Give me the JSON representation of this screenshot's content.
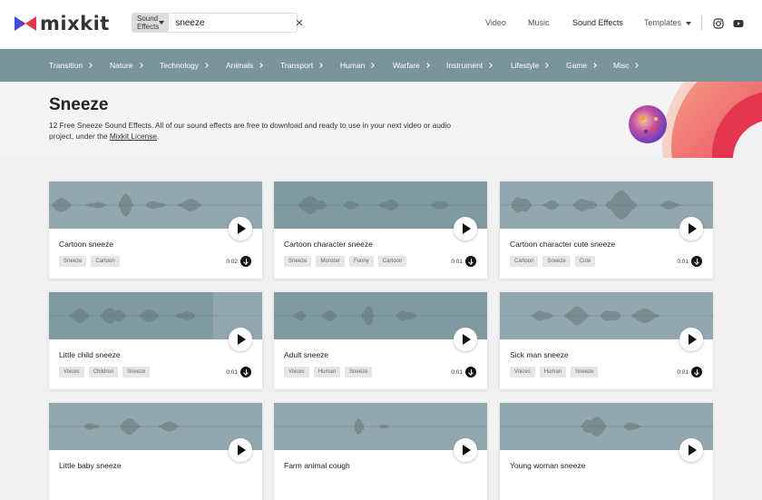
{
  "header": {
    "logo_text": "mixkit",
    "search": {
      "category": "Sound Effects",
      "query": "sneeze",
      "clear": "✕"
    },
    "nav": [
      "Video",
      "Music",
      "Sound Effects",
      "Templates"
    ]
  },
  "categories": [
    "Transition",
    "Nature",
    "Technology",
    "Animals",
    "Transport",
    "Human",
    "Warfare",
    "Instrument",
    "Lifestyle",
    "Game",
    "Misc"
  ],
  "hero": {
    "title": "Sneeze",
    "desc_before": "12 Free Sneeze Sound Effects. All of our sound effects are free to download and ready to use in your next video or audio project, under the ",
    "license_link": "Mixkit License",
    "desc_after": "."
  },
  "cards": [
    {
      "title": "Cartoon sneeze",
      "tags": [
        "Sneeze",
        "Cartoon"
      ],
      "duration": "0:02",
      "progress": 0
    },
    {
      "title": "Cartoon character sneeze",
      "tags": [
        "Sneeze",
        "Monster",
        "Funny",
        "Cartoon"
      ],
      "duration": "0:01",
      "progress": 1
    },
    {
      "title": "Cartoon character cute sneeze",
      "tags": [
        "Cartoon",
        "Sneeze",
        "Cute"
      ],
      "duration": "0:01",
      "progress": 0
    },
    {
      "title": "Little child sneeze",
      "tags": [
        "Voices",
        "Children",
        "Sneeze"
      ],
      "duration": "0:01",
      "progress": 0.77
    },
    {
      "title": "Adult sneeze",
      "tags": [
        "Voices",
        "Human",
        "Sneeze"
      ],
      "duration": "0:01",
      "progress": 1
    },
    {
      "title": "Sick man sneeze",
      "tags": [
        "Voices",
        "Human",
        "Sneeze"
      ],
      "duration": "0:01",
      "progress": 0
    },
    {
      "title": "Little baby sneeze",
      "tags": [],
      "duration": "",
      "progress": 0
    },
    {
      "title": "Farm animal cough",
      "tags": [],
      "duration": "",
      "progress": 0
    },
    {
      "title": "Young woman sneeze",
      "tags": [],
      "duration": "",
      "progress": 0
    }
  ],
  "colors": {
    "accent": "#e8354a",
    "category_bar": "#7b949c",
    "wave_bg": "#93a8ae",
    "wave_played": "#809aa1"
  }
}
